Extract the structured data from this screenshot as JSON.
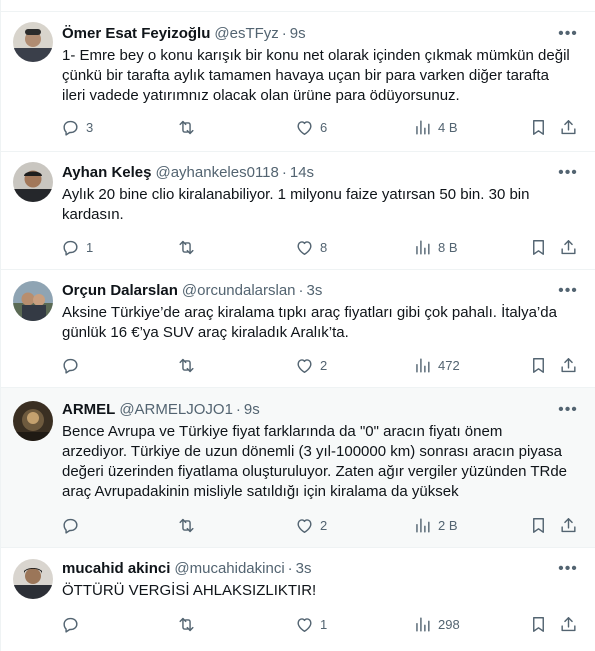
{
  "tweets": [
    {
      "name": "Ömer Esat Feyizoğlu",
      "handle": "@esTFyz",
      "dot": "·",
      "time": "9s",
      "lines": [
        "1- Emre bey o konu karışık bir konu net olarak içinden çıkmak mümkün değil",
        "çünkü bir tarafta aylık tamamen havaya uçan bir para varken diğer tarafta",
        "ileri vadede yatırımnız olacak olan ürüne para ödüyorsunuz."
      ],
      "replies": "3",
      "retweets": "",
      "likes": "6",
      "views": "4 B"
    },
    {
      "name": "Ayhan Keleş",
      "handle": "@ayhankeles0118",
      "dot": "·",
      "time": "14s",
      "lines": [
        "Aylık 20 bine clio kiralanabiliyor. 1 milyonu faize yatırsan 50 bin. 30 bin",
        "kardasın."
      ],
      "replies": "1",
      "retweets": "",
      "likes": "8",
      "views": "8 B"
    },
    {
      "name": "Orçun Dalarslan",
      "handle": "@orcundalarslan",
      "dot": "·",
      "time": "3s",
      "lines": [
        "Aksine Türkiye’de araç kiralama tıpkı araç fiyatları gibi çok pahalı. İtalya’da",
        "günlük 16 €’ya SUV araç kiraladık Aralık’ta."
      ],
      "replies": "",
      "retweets": "",
      "likes": "2",
      "views": "472"
    },
    {
      "name": "ARMEL",
      "handle": "@ARMELJOJO1",
      "dot": "·",
      "time": "9s",
      "lines": [
        "Bence Avrupa ve Türkiye fiyat farklarında da \"0\" aracın fiyatı önem",
        "arzediyor. Türkiye de uzun dönemli (3 yıl-100000 km) sonrası aracın piyasa",
        "değeri üzerinden fiyatlama oluşturuluyor. Zaten ağır vergiler yüzünden TRde",
        "araç Avrupadakinin misliyle satıldığı için kiralama da yüksek"
      ],
      "replies": "",
      "retweets": "",
      "likes": "2",
      "views": "2 B"
    },
    {
      "name": "mucahid akinci",
      "handle": "@mucahidakinci",
      "dot": "·",
      "time": "3s",
      "lines": [
        "ÖTTÜRÜ VERGİSİ AHLAKSIZLIKTIR!"
      ],
      "replies": "",
      "retweets": "",
      "likes": "1",
      "views": "298"
    }
  ],
  "icons": {
    "more": "more-icon",
    "reply": "reply-icon",
    "retweet": "retweet-icon",
    "like": "like-icon",
    "views": "views-icon",
    "bookmark": "bookmark-icon",
    "share": "share-icon"
  },
  "colors": {
    "text": "#0f1419",
    "secondary": "#536471",
    "divider": "#eff3f4",
    "highlight_bg": "#f7f9f9"
  }
}
